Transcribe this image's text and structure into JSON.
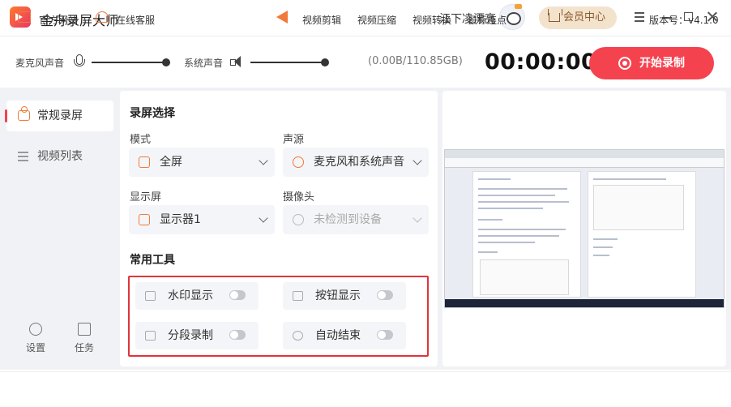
{
  "app": {
    "title": "金舟录屏大师",
    "username": "江下凌漂亮",
    "vip_label": "会员中心"
  },
  "audio": {
    "mic_label": "麦克风声音",
    "system_label": "系统声音",
    "mic_level": 1.0,
    "system_level": 1.0,
    "storage": "(0.00B/110.85GB)",
    "timer": "00:00:00",
    "record_label": "开始录制"
  },
  "sidebar": {
    "items": [
      {
        "label": "常规录屏",
        "icon": "camera-icon",
        "active": true
      },
      {
        "label": "视频列表",
        "icon": "list-icon",
        "active": false
      }
    ],
    "settings_label": "设置",
    "tasks_label": "任务"
  },
  "panel": {
    "section_title": "录屏选择",
    "mode_label": "模式",
    "mode_value": "全屏",
    "audio_source_label": "声源",
    "audio_source_value": "麦克风和系统声音",
    "display_label": "显示屏",
    "display_value": "显示器1",
    "camera_label": "摄像头",
    "camera_value": "未检测到设备",
    "tools_title": "常用工具",
    "tools": [
      {
        "label": "水印显示",
        "icon": "watermark-icon",
        "enabled": false
      },
      {
        "label": "按钮显示",
        "icon": "keyboard-icon",
        "enabled": false
      },
      {
        "label": "分段录制",
        "icon": "segment-icon",
        "enabled": false
      },
      {
        "label": "自动结束",
        "icon": "power-icon",
        "enabled": false
      }
    ]
  },
  "footer": {
    "website": "官方网站",
    "service": "在线客服",
    "links": [
      "视频剪辑",
      "视频压缩",
      "视频转换",
      "鼠标连点"
    ],
    "version": "版本号：v4.1.0"
  },
  "colors": {
    "accent": "#f5424f",
    "highlight_border": "#e0353b",
    "icon_orange": "#f07a3a"
  }
}
